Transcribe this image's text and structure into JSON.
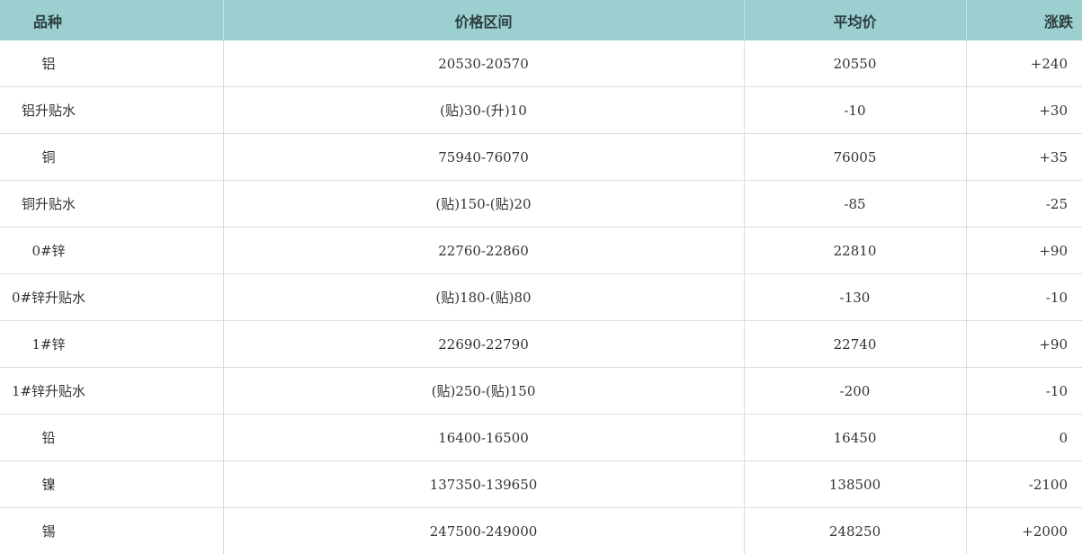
{
  "table": {
    "headers": {
      "variety": "品种",
      "price_range": "价格区间",
      "average_price": "平均价",
      "change": "涨跌"
    },
    "rows": [
      {
        "variety": "铝",
        "price_range": "20530-20570",
        "average_price": "20550",
        "change": "+240"
      },
      {
        "variety": "铝升贴水",
        "price_range": "(贴)30-(升)10",
        "average_price": "-10",
        "change": "+30"
      },
      {
        "variety": "铜",
        "price_range": "75940-76070",
        "average_price": "76005",
        "change": "+35"
      },
      {
        "variety": "铜升贴水",
        "price_range": "(贴)150-(贴)20",
        "average_price": "-85",
        "change": "-25"
      },
      {
        "variety": "0#锌",
        "price_range": "22760-22860",
        "average_price": "22810",
        "change": "+90"
      },
      {
        "variety": "0#锌升贴水",
        "price_range": "(贴)180-(贴)80",
        "average_price": "-130",
        "change": "-10"
      },
      {
        "variety": "1#锌",
        "price_range": "22690-22790",
        "average_price": "22740",
        "change": "+90"
      },
      {
        "variety": "1#锌升贴水",
        "price_range": "(贴)250-(贴)150",
        "average_price": "-200",
        "change": "-10"
      },
      {
        "variety": "铅",
        "price_range": "16400-16500",
        "average_price": "16450",
        "change": "0"
      },
      {
        "variety": "镍",
        "price_range": "137350-139650",
        "average_price": "138500",
        "change": "-2100"
      },
      {
        "variety": "锡",
        "price_range": "247500-249000",
        "average_price": "248250",
        "change": "+2000"
      }
    ]
  },
  "colors": {
    "header_background": "#9ccfd0",
    "grid_line": "#dcdcdc",
    "text": "#333333"
  }
}
